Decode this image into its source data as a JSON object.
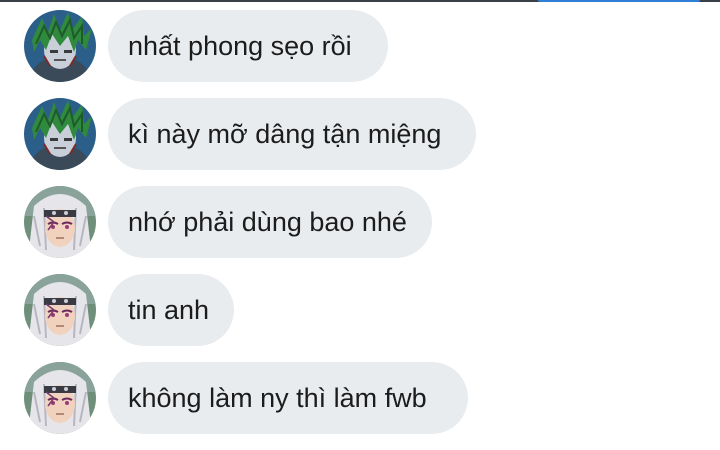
{
  "conversation": {
    "messages": [
      {
        "sender_avatar": "avatar-green-haired",
        "text": "nhất phong sẹo rồi"
      },
      {
        "sender_avatar": "avatar-green-haired",
        "text": "kì này mỡ dâng tận miệng"
      },
      {
        "sender_avatar": "avatar-white-haired",
        "text": "nhớ phải dùng bao nhé"
      },
      {
        "sender_avatar": "avatar-white-haired",
        "text": "tin anh"
      },
      {
        "sender_avatar": "avatar-white-haired",
        "text": "không làm ny thì làm fwb"
      }
    ]
  },
  "colors": {
    "bubble_bg": "#e9ecef",
    "text": "#1c1c1c",
    "accent": "#2f7fd6",
    "top_bar": "#3a3f47"
  }
}
